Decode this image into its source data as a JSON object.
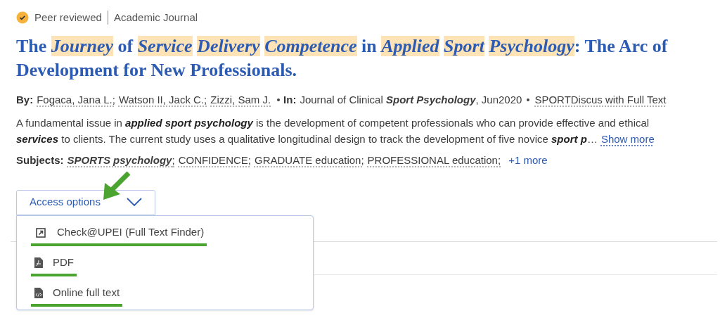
{
  "badges": {
    "peer_reviewed": "Peer reviewed",
    "type": "Academic Journal"
  },
  "title": "The *Journey* of *Service* *Delivery* *Competence* in *Applied* *Sport* *Psychology*: The Arc of Development for New Professionals.",
  "byline": {
    "label": "By:",
    "authors": [
      "Fogaca, Jana L.;",
      "Watson II, Jack C.;",
      "Zizzi, Sam J."
    ],
    "in_label": "In:",
    "source": "Journal of Clinical **Sport Psychology**, Jun2020",
    "database": "SPORTDiscus with Full Text"
  },
  "abstract": {
    "lines": [
      "A fundamental issue in **applied sport psychology** is the development of competent professionals who can provide effective and ethical",
      "**services** to clients. The current study uses a qualitative longitudinal design to track the development of five novice **sport p**…"
    ],
    "show_more": "Show more"
  },
  "subjects": {
    "label": "Subjects:",
    "items": [
      "**SPORTS psychology**;",
      "CONFIDENCE;",
      "GRADUATE education;",
      "PROFESSIONAL education;"
    ],
    "more": "+1 more"
  },
  "access": {
    "label": "Access options",
    "expanded": true,
    "options": [
      {
        "kind": "link",
        "label": "Check@UPEI (Full Text Finder)"
      },
      {
        "kind": "pdf",
        "label": "PDF"
      },
      {
        "kind": "html",
        "label": "Online full text"
      }
    ]
  }
}
